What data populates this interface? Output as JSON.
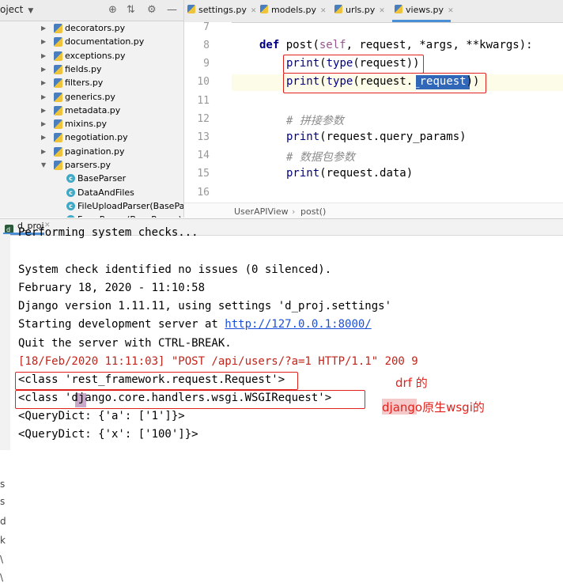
{
  "project_panel": {
    "title": "oject",
    "header_icons": [
      "target-icon",
      "collapse-icon",
      "gear-icon",
      "minimize-icon"
    ],
    "items": [
      {
        "label": "decorators.py",
        "kind": "file"
      },
      {
        "label": "documentation.py",
        "kind": "file"
      },
      {
        "label": "exceptions.py",
        "kind": "file"
      },
      {
        "label": "fields.py",
        "kind": "file"
      },
      {
        "label": "filters.py",
        "kind": "file"
      },
      {
        "label": "generics.py",
        "kind": "file"
      },
      {
        "label": "metadata.py",
        "kind": "file"
      },
      {
        "label": "mixins.py",
        "kind": "file"
      },
      {
        "label": "negotiation.py",
        "kind": "file"
      },
      {
        "label": "pagination.py",
        "kind": "file"
      },
      {
        "label": "parsers.py",
        "kind": "file-open"
      },
      {
        "label": "BaseParser",
        "kind": "class"
      },
      {
        "label": "DataAndFiles",
        "kind": "class"
      },
      {
        "label": "FileUploadParser(BaseParser)",
        "kind": "class"
      },
      {
        "label": "FormParser(BaseParser)",
        "kind": "class"
      }
    ]
  },
  "editor": {
    "tabs": [
      "settings.py",
      "models.py",
      "urls.py",
      "views.py"
    ],
    "active_tab": "views.py",
    "line_numbers": [
      "7",
      "8",
      "9",
      "10",
      "11",
      "12",
      "13",
      "14",
      "15",
      "16"
    ],
    "lines": {
      "l8_kw": "def",
      "l8_name": " post(",
      "l8_self": "self",
      "l8_rest": ", request, *args, **kwargs):",
      "l9_print": "print",
      "l9_mid": "(",
      "l9_type": "type",
      "l9_rest": "(request))",
      "l10_print": "print",
      "l10_mid": "(",
      "l10_type": "type",
      "l10_pre": "(request.",
      "l10_sel": "_request",
      "l10_post": "))",
      "l12": "# 拼接参数",
      "l13_print": "print",
      "l13_rest": "(request.query_params)",
      "l14": "# 数据包参数",
      "l15_print": "print",
      "l15_rest": "(request.data)"
    },
    "breadcrumb": [
      "UserAPIView",
      "post()"
    ]
  },
  "run_panel": {
    "tab_label": "d_proj",
    "console": [
      "Performing system checks...",
      "",
      "System check identified no issues (0 silenced).",
      "February 18, 2020 - 11:10:58",
      "Django version 1.11.11, using settings 'd_proj.settings'",
      "Starting development server at ",
      "Quit the server with CTRL-BREAK.",
      "[18/Feb/2020 11:11:03] \"POST /api/users/?a=1 HTTP/1.1\" 200 9",
      "<class 'rest_framework.request.Request'>",
      "<class 'django.core.handlers.wsgi.WSGIRequest'>",
      "<QueryDict: {'a': ['1']}>",
      "<QueryDict: {'x': ['100']}>"
    ],
    "server_url": "http://127.0.0.1:8000/",
    "gutter_chars": [
      "s",
      "s",
      "d",
      "k",
      "\\",
      "\\"
    ]
  },
  "annotations": {
    "drf_note": "drf 的",
    "django_note": "django原生wsgi的"
  },
  "colors": {
    "annotation_red": "#e0211c",
    "selection_blue": "#3067b8",
    "link_blue": "#1a4fd8"
  }
}
